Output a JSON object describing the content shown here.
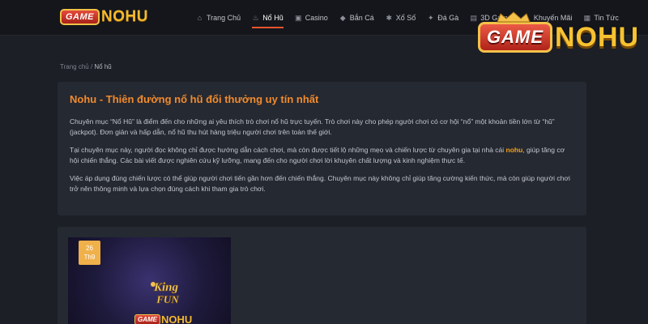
{
  "header": {
    "logo_left": "GAME",
    "logo_right": "NOHU",
    "nav": [
      {
        "label": "Trang Chủ",
        "icon": "home-icon",
        "glyph": "⌂",
        "active": false
      },
      {
        "label": "Nổ Hũ",
        "icon": "pot-icon",
        "glyph": "♨",
        "active": true
      },
      {
        "label": "Casino",
        "icon": "casino-icon",
        "glyph": "▣",
        "active": false
      },
      {
        "label": "Bắn Cá",
        "icon": "fish-icon",
        "glyph": "◆",
        "active": false
      },
      {
        "label": "Xổ Số",
        "icon": "lottery-icon",
        "glyph": "✱",
        "active": false
      },
      {
        "label": "Đá Gà",
        "icon": "rooster-icon",
        "glyph": "✦",
        "active": false
      },
      {
        "label": "3D Game",
        "icon": "game-icon",
        "glyph": "▤",
        "active": false
      },
      {
        "label": "Khuyến Mãi",
        "icon": "gift-icon",
        "glyph": "●",
        "active": false
      },
      {
        "label": "Tin Tức",
        "icon": "news-icon",
        "glyph": "▦",
        "active": false
      }
    ]
  },
  "corner_logo": {
    "left": "GAME",
    "right": "NOHU"
  },
  "breadcrumb": {
    "home": "Trang chủ",
    "separator": " / ",
    "current": "Nổ hũ"
  },
  "article": {
    "title": "Nohu - Thiên đường nổ hũ đổi thưởng uy tín nhất",
    "p1": "Chuyên mục “Nổ Hũ” là điểm đến cho những ai yêu thích trò chơi nổ hũ trực tuyến. Trò chơi này cho phép người chơi có cơ hội “nổ” một khoản tiền lớn từ “hũ” (jackpot). Đơn giản và hấp dẫn, nổ hũ thu hút hàng triệu người chơi trên toàn thế giới.",
    "p2_before": "Tại chuyên mục này, người đọc không chỉ được hướng dẫn cách chơi, mà còn được tiết lộ những mẹo và chiến lược từ chuyên gia tại nhà cái ",
    "p2_highlight": "nohu",
    "p2_after": ", giúp tăng cơ hội chiến thắng. Các bài viết được nghiên cứu kỹ lưỡng, mang đến cho người chơi lời khuyên chất lượng và kinh nghiệm thực tế.",
    "p3": "Việc áp dụng đúng chiến lược có thể giúp người chơi tiến gần hơn đến chiến thắng. Chuyên mục này không chỉ giúp tăng cường kiến thức, mà còn giúp người chơi trở nên thông minh và lựa chọn đúng cách khi tham gia trò chơi."
  },
  "post_card": {
    "day": "26",
    "month": "Th9",
    "game_logo_top": "King",
    "game_logo_bottom": "FUN",
    "brand_left": "GAME",
    "brand_right": "NOHU"
  },
  "colors": {
    "accent": "#f28b2c",
    "highlight": "#f6a019",
    "badge": "#f0b04a",
    "nav_active": "#e8542e"
  }
}
